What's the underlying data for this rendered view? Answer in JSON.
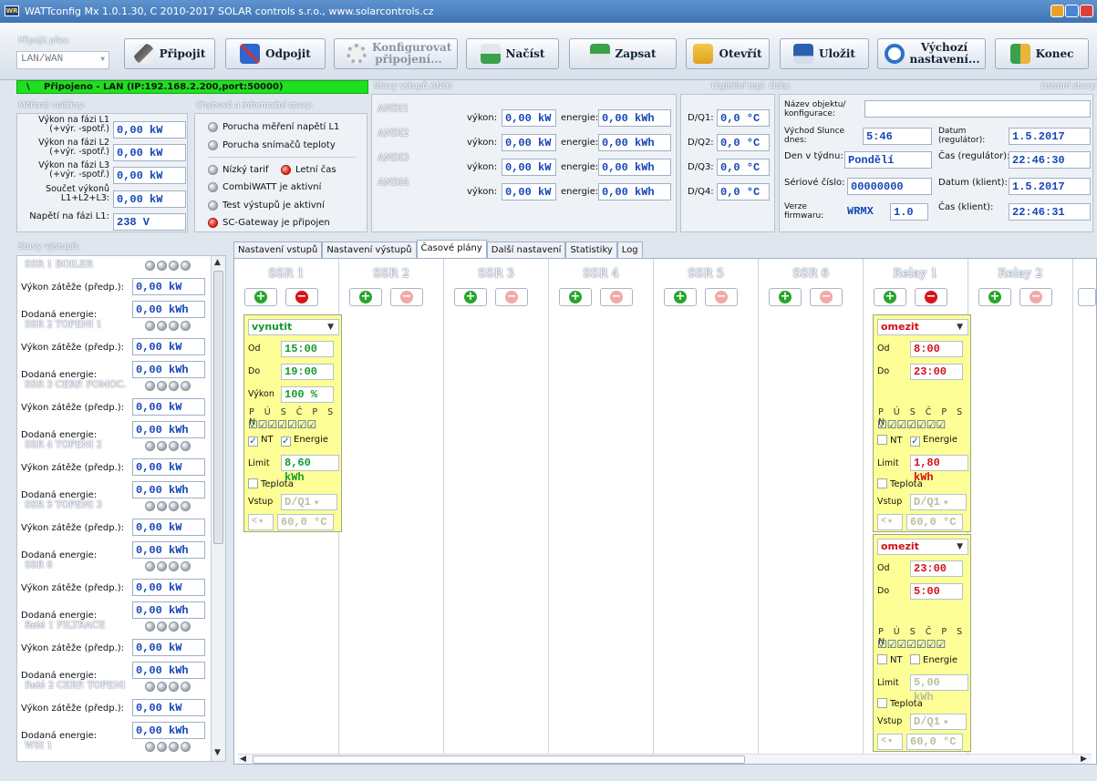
{
  "window": {
    "title": "WATTconfig Mx 1.0.1.30, C 2010-2017 SOLAR controls s.r.o., www.solarcontrols.cz",
    "app_icon": "WR"
  },
  "toolbar": {
    "connect_via_label": "Připojit přes:",
    "connect_via_value": "LAN/WAN",
    "buttons": {
      "connect": "Připojit",
      "disconnect": "Odpojit",
      "configure": "Konfigurovat připojení...",
      "load": "Načíst",
      "write": "Zapsat",
      "open": "Otevřít",
      "save": "Uložit",
      "defaults": "Výchozí nastavení...",
      "exit": "Konec"
    }
  },
  "status": {
    "connection_text": "Připojeno - LAN (IP:192.168.2.200,port:50000)",
    "connection_prefix": "\\",
    "andi_title": "Stavy vstupů ANDI:",
    "digital_title": "Digitální tepl. čidla:",
    "other_title": "Ostatní stavy:"
  },
  "measured": {
    "title": "Měřené veličiny:",
    "rows": [
      {
        "label": "Výkon na fázi L1 (+výr. -spotř.)",
        "value": "0,00 kW"
      },
      {
        "label": "Výkon na fázi L2 (+výr. -spotř.)",
        "value": "0,00 kW"
      },
      {
        "label": "Výkon na fázi L3 (+výr. -spotř.)",
        "value": "0,00 kW"
      },
      {
        "label": "Součet výkonů L1+L2+L3:",
        "value": "0,00 kW"
      },
      {
        "label": "Napětí na fázi L1:",
        "value": "238 V"
      }
    ]
  },
  "errors": {
    "title": "Chybové a informační stavy:",
    "items": [
      {
        "label": "Porucha měření napětí L1",
        "active": false
      },
      {
        "label": "Porucha snímačů teploty",
        "active": false
      },
      {
        "label": "Nízký tarif",
        "active": false
      },
      {
        "label": "Letní čas",
        "active": true
      },
      {
        "label": "CombiWATT je aktivní",
        "active": false
      },
      {
        "label": "Test výstupů je aktivní",
        "active": false
      },
      {
        "label": "SC-Gateway je připojen",
        "active": true
      }
    ]
  },
  "andi": [
    {
      "name": "ANDI1",
      "power_label": "výkon:",
      "power": "0,00 kW",
      "energy_label": "energie:",
      "energy": "0,00 kWh"
    },
    {
      "name": "ANDI2",
      "power_label": "výkon:",
      "power": "0,00 kW",
      "energy_label": "energie:",
      "energy": "0,00 kWh"
    },
    {
      "name": "ANDI3",
      "power_label": "výkon:",
      "power": "0,00 kW",
      "energy_label": "energie:",
      "energy": "0,00 kWh"
    },
    {
      "name": "ANDI4",
      "power_label": "výkon:",
      "power": "0,00 kW",
      "energy_label": "energie:",
      "energy": "0,00 kWh"
    }
  ],
  "digital": [
    {
      "name": "D/Q1:",
      "value": "0,0 °C"
    },
    {
      "name": "D/Q2:",
      "value": "0,0 °C"
    },
    {
      "name": "D/Q3:",
      "value": "0,0 °C"
    },
    {
      "name": "D/Q4:",
      "value": "0,0 °C"
    }
  ],
  "other": {
    "object_name_label": "Název objektu/ konfigurace:",
    "object_name_value": "",
    "sunrise_label": "Východ Slunce dnes:",
    "sunrise_value": "5:46",
    "date_reg_label": "Datum (regulátor):",
    "date_reg_value": "1.5.2017",
    "weekday_label": "Den v týdnu:",
    "weekday_value": "Pondělí",
    "time_reg_label": "Čas (regulátor):",
    "time_reg_value": "22:46:30",
    "serial_label": "Sériové číslo:",
    "serial_value": "00000000",
    "date_client_label": "Datum (klient):",
    "date_client_value": "1.5.2017",
    "firmware_label": "Verze firmwaru:",
    "firmware_name": "WRMX",
    "firmware_version": "1.0",
    "time_client_label": "Čas (klient):",
    "time_client_value": "22:46:31"
  },
  "outputs": {
    "title": "Stavy výstupů:",
    "load_label": "Výkon zátěže (předp.):",
    "energy_label": "Dodaná energie:",
    "items": [
      {
        "name": "SSR 1 BOILER",
        "load": "0,00 kW",
        "energy": "0,00 kWh"
      },
      {
        "name": "SSR 2 TOPENI 1",
        "load": "0,00 kW",
        "energy": "0,00 kWh"
      },
      {
        "name": "SSR 3 CERP. POMOC.",
        "load": "0,00 kW",
        "energy": "0,00 kWh"
      },
      {
        "name": "SSR 4 TOPENI 2",
        "load": "0,00 kW",
        "energy": "0,00 kWh"
      },
      {
        "name": "SSR 5 TOPENI 3",
        "load": "0,00 kW",
        "energy": "0,00 kWh"
      },
      {
        "name": "SSR 6",
        "load": "0,00 kW",
        "energy": "0,00 kWh"
      },
      {
        "name": "Relé 1 FILTRACE",
        "load": "0,00 kW",
        "energy": "0,00 kWh"
      },
      {
        "name": "Relé 2 CERP. TOPENI",
        "load": "0,00 kW",
        "energy": "0,00 kWh"
      },
      {
        "name": "WSI 1"
      }
    ]
  },
  "tabs": [
    "Nastavení vstupů",
    "Nastavení výstupů",
    "Časové plány",
    "Další nastavení",
    "Statistiky",
    "Log"
  ],
  "schedule": {
    "columns": [
      "SSR 1",
      "SSR 2",
      "SSR 3",
      "SSR 4",
      "SSR 5",
      "SSR 6",
      "Relay 1",
      "Relay 2"
    ],
    "labels": {
      "from": "Od",
      "to": "Do",
      "power": "Výkon",
      "limit": "Limit",
      "days": "P Ú S Č P S N",
      "nt": "NT",
      "energy": "Energie",
      "temp": "Teplota",
      "input": "Vstup",
      "cmp": "<"
    },
    "cards": [
      {
        "mode": "vynutit",
        "from": "15:00",
        "to": "19:00",
        "power": "100 %",
        "limit": "8,60 kWh",
        "input": "D/Q1",
        "temp": "60,0 °C"
      },
      {
        "mode": "omezit",
        "from": "8:00",
        "to": "23:00",
        "limit": "1,80 kWh",
        "input": "D/Q1",
        "temp": "60,0 °C"
      },
      {
        "mode": "omezit",
        "from": "23:00",
        "to": "5:00",
        "limit": "5,00 kWh",
        "input": "D/Q1",
        "temp": "60,0 °C"
      }
    ]
  }
}
